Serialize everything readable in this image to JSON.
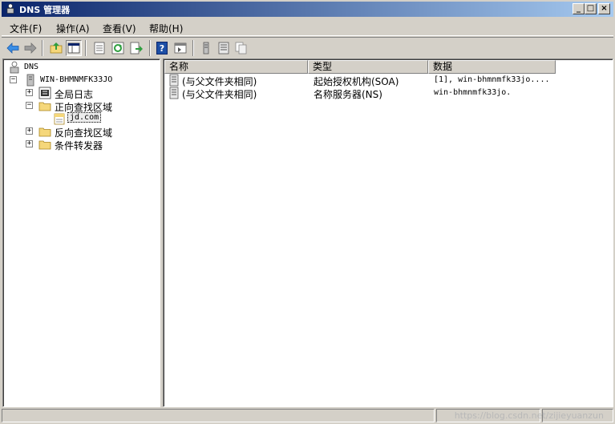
{
  "window": {
    "title": "DNS 管理器",
    "controls": {
      "minimize": "_",
      "maximize": "□",
      "close": "×"
    }
  },
  "menu": [
    {
      "label": "文件(F)"
    },
    {
      "label": "操作(A)"
    },
    {
      "label": "查看(V)"
    },
    {
      "label": "帮助(H)"
    }
  ],
  "toolbar": {
    "icons": [
      "back-icon",
      "forward-icon",
      "up-folder-icon",
      "show-hide-tree-icon",
      "properties-icon",
      "refresh-icon",
      "export-list-icon",
      "help-icon",
      "show-console-icon",
      "server-icon",
      "zone-list-icon",
      "copy-icon"
    ]
  },
  "tree": {
    "root": "DNS",
    "server": "WIN-BHMNMFK33JO",
    "items": [
      {
        "label": "全局日志"
      },
      {
        "label": "正向查找区域"
      },
      {
        "label": "jd.com"
      },
      {
        "label": "反向查找区域"
      },
      {
        "label": "条件转发器"
      }
    ],
    "expand_plus": "+",
    "expand_minus": "−"
  },
  "list": {
    "columns": [
      "名称",
      "类型",
      "数据"
    ],
    "rows": [
      {
        "name": "(与父文件夹相同)",
        "type": "起始授权机构(SOA)",
        "data": "[1], win-bhmnmfk33jo...."
      },
      {
        "name": "(与父文件夹相同)",
        "type": "名称服务器(NS)",
        "data": "win-bhmnmfk33jo."
      }
    ]
  },
  "status": {
    "watermark": "https://blog.csdn.net/zijieyuanzun"
  },
  "colors": {
    "title_start": "#0a246a",
    "title_end": "#a6caf0",
    "face": "#d4d0c8",
    "folder": "#f5d77a"
  }
}
